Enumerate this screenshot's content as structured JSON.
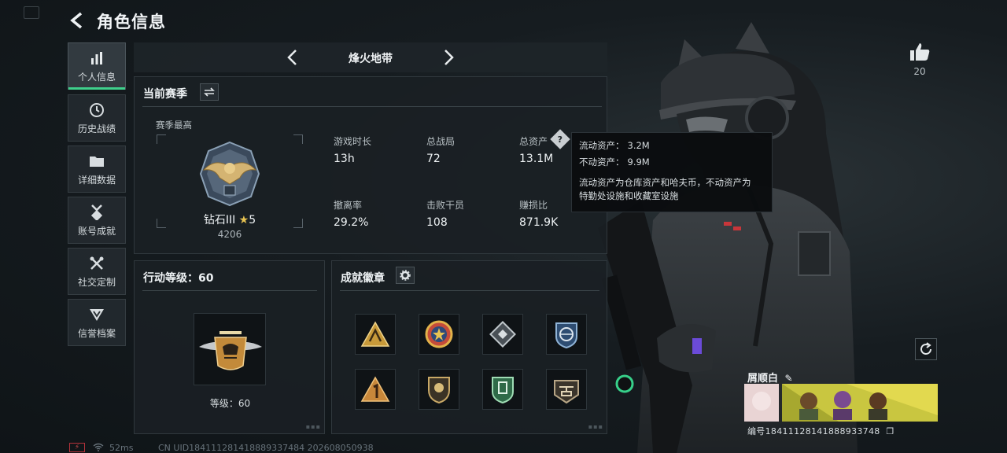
{
  "header": {
    "title": "角色信息"
  },
  "sidebar": {
    "items": [
      {
        "label": "个人信息",
        "icon": "bar-chart-icon",
        "active": true
      },
      {
        "label": "历史战绩",
        "icon": "clock-icon"
      },
      {
        "label": "详细数据",
        "icon": "folder-icon"
      },
      {
        "label": "账号成就",
        "icon": "medal-icon"
      },
      {
        "label": "社交定制",
        "icon": "tools-icon"
      },
      {
        "label": "信誉档案",
        "icon": "shield-icon"
      }
    ]
  },
  "mode": {
    "title": "烽火地带"
  },
  "season": {
    "title": "当前赛季",
    "highest_label": "赛季最高",
    "rank_name": "钻石III",
    "rank_stars": "5",
    "rank_points": "4206",
    "stats": [
      {
        "label": "游戏时长",
        "value": "13h"
      },
      {
        "label": "总战局",
        "value": "72"
      },
      {
        "label": "总资产",
        "value": "13.1M"
      },
      {
        "label": "撤离率",
        "value": "29.2%"
      },
      {
        "label": "击败干员",
        "value": "108"
      },
      {
        "label": "赚损比",
        "value": "871.9K"
      }
    ]
  },
  "tooltip": {
    "liquid_label": "流动资产：",
    "liquid_value": "3.2M",
    "fixed_label": "不动资产：",
    "fixed_value": "9.9M",
    "note_line1": "流动资产为仓库资产和哈夫币，不动资产为",
    "note_line2": "特勤处设施和收藏室设施"
  },
  "action_level": {
    "title": "行动等级：60",
    "level_text": "等级：60"
  },
  "badges": {
    "title": "成就徽章",
    "items": [
      {
        "icon": "triangle-badge-icon",
        "color": "#c89a3a"
      },
      {
        "icon": "star-medal-icon",
        "color": "#c44b3a"
      },
      {
        "icon": "diamond-badge-icon",
        "color": "#9aa3a8"
      },
      {
        "icon": "globe-badge-icon",
        "color": "#4f7fb0"
      },
      {
        "icon": "number-one-badge-icon",
        "color": "#c8873a"
      },
      {
        "icon": "shield-badge-icon",
        "color": "#a88a55"
      },
      {
        "icon": "green-shield-badge-icon",
        "color": "#4aa06a"
      },
      {
        "icon": "helicopter-badge-icon",
        "color": "#9a8a70"
      }
    ]
  },
  "profile": {
    "likes": "20",
    "name": "屑顺白",
    "uid_line": "编号18411128141888933748"
  },
  "footer": {
    "ping": "52ms",
    "uid_text": "CN UID184111281418889337484 202608050938"
  },
  "colors": {
    "accent": "#3fd08c",
    "tooltip_bg": "#0a0d0f"
  }
}
